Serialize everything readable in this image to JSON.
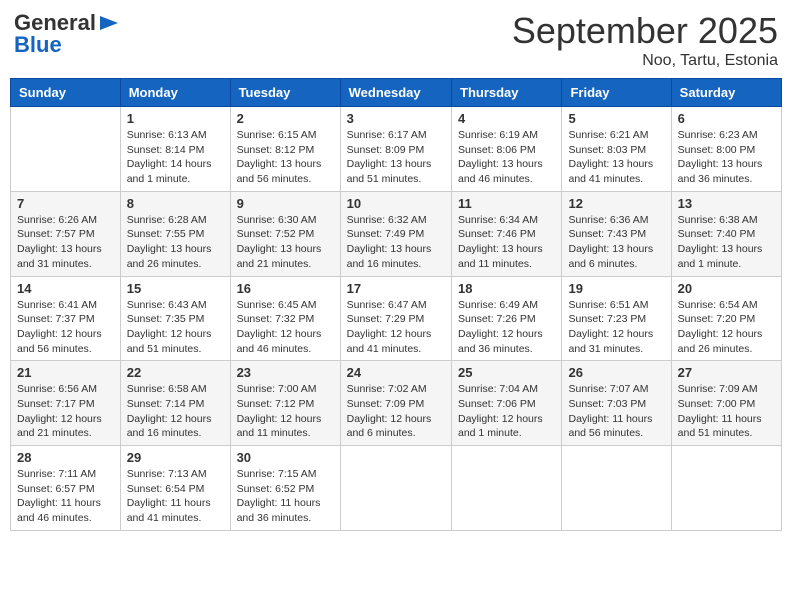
{
  "header": {
    "logo_general": "General",
    "logo_blue": "Blue",
    "month": "September 2025",
    "location": "Noo, Tartu, Estonia"
  },
  "weekdays": [
    "Sunday",
    "Monday",
    "Tuesday",
    "Wednesday",
    "Thursday",
    "Friday",
    "Saturday"
  ],
  "weeks": [
    [
      {
        "day": "",
        "info": ""
      },
      {
        "day": "1",
        "info": "Sunrise: 6:13 AM\nSunset: 8:14 PM\nDaylight: 14 hours\nand 1 minute."
      },
      {
        "day": "2",
        "info": "Sunrise: 6:15 AM\nSunset: 8:12 PM\nDaylight: 13 hours\nand 56 minutes."
      },
      {
        "day": "3",
        "info": "Sunrise: 6:17 AM\nSunset: 8:09 PM\nDaylight: 13 hours\nand 51 minutes."
      },
      {
        "day": "4",
        "info": "Sunrise: 6:19 AM\nSunset: 8:06 PM\nDaylight: 13 hours\nand 46 minutes."
      },
      {
        "day": "5",
        "info": "Sunrise: 6:21 AM\nSunset: 8:03 PM\nDaylight: 13 hours\nand 41 minutes."
      },
      {
        "day": "6",
        "info": "Sunrise: 6:23 AM\nSunset: 8:00 PM\nDaylight: 13 hours\nand 36 minutes."
      }
    ],
    [
      {
        "day": "7",
        "info": "Sunrise: 6:26 AM\nSunset: 7:57 PM\nDaylight: 13 hours\nand 31 minutes."
      },
      {
        "day": "8",
        "info": "Sunrise: 6:28 AM\nSunset: 7:55 PM\nDaylight: 13 hours\nand 26 minutes."
      },
      {
        "day": "9",
        "info": "Sunrise: 6:30 AM\nSunset: 7:52 PM\nDaylight: 13 hours\nand 21 minutes."
      },
      {
        "day": "10",
        "info": "Sunrise: 6:32 AM\nSunset: 7:49 PM\nDaylight: 13 hours\nand 16 minutes."
      },
      {
        "day": "11",
        "info": "Sunrise: 6:34 AM\nSunset: 7:46 PM\nDaylight: 13 hours\nand 11 minutes."
      },
      {
        "day": "12",
        "info": "Sunrise: 6:36 AM\nSunset: 7:43 PM\nDaylight: 13 hours\nand 6 minutes."
      },
      {
        "day": "13",
        "info": "Sunrise: 6:38 AM\nSunset: 7:40 PM\nDaylight: 13 hours\nand 1 minute."
      }
    ],
    [
      {
        "day": "14",
        "info": "Sunrise: 6:41 AM\nSunset: 7:37 PM\nDaylight: 12 hours\nand 56 minutes."
      },
      {
        "day": "15",
        "info": "Sunrise: 6:43 AM\nSunset: 7:35 PM\nDaylight: 12 hours\nand 51 minutes."
      },
      {
        "day": "16",
        "info": "Sunrise: 6:45 AM\nSunset: 7:32 PM\nDaylight: 12 hours\nand 46 minutes."
      },
      {
        "day": "17",
        "info": "Sunrise: 6:47 AM\nSunset: 7:29 PM\nDaylight: 12 hours\nand 41 minutes."
      },
      {
        "day": "18",
        "info": "Sunrise: 6:49 AM\nSunset: 7:26 PM\nDaylight: 12 hours\nand 36 minutes."
      },
      {
        "day": "19",
        "info": "Sunrise: 6:51 AM\nSunset: 7:23 PM\nDaylight: 12 hours\nand 31 minutes."
      },
      {
        "day": "20",
        "info": "Sunrise: 6:54 AM\nSunset: 7:20 PM\nDaylight: 12 hours\nand 26 minutes."
      }
    ],
    [
      {
        "day": "21",
        "info": "Sunrise: 6:56 AM\nSunset: 7:17 PM\nDaylight: 12 hours\nand 21 minutes."
      },
      {
        "day": "22",
        "info": "Sunrise: 6:58 AM\nSunset: 7:14 PM\nDaylight: 12 hours\nand 16 minutes."
      },
      {
        "day": "23",
        "info": "Sunrise: 7:00 AM\nSunset: 7:12 PM\nDaylight: 12 hours\nand 11 minutes."
      },
      {
        "day": "24",
        "info": "Sunrise: 7:02 AM\nSunset: 7:09 PM\nDaylight: 12 hours\nand 6 minutes."
      },
      {
        "day": "25",
        "info": "Sunrise: 7:04 AM\nSunset: 7:06 PM\nDaylight: 12 hours\nand 1 minute."
      },
      {
        "day": "26",
        "info": "Sunrise: 7:07 AM\nSunset: 7:03 PM\nDaylight: 11 hours\nand 56 minutes."
      },
      {
        "day": "27",
        "info": "Sunrise: 7:09 AM\nSunset: 7:00 PM\nDaylight: 11 hours\nand 51 minutes."
      }
    ],
    [
      {
        "day": "28",
        "info": "Sunrise: 7:11 AM\nSunset: 6:57 PM\nDaylight: 11 hours\nand 46 minutes."
      },
      {
        "day": "29",
        "info": "Sunrise: 7:13 AM\nSunset: 6:54 PM\nDaylight: 11 hours\nand 41 minutes."
      },
      {
        "day": "30",
        "info": "Sunrise: 7:15 AM\nSunset: 6:52 PM\nDaylight: 11 hours\nand 36 minutes."
      },
      {
        "day": "",
        "info": ""
      },
      {
        "day": "",
        "info": ""
      },
      {
        "day": "",
        "info": ""
      },
      {
        "day": "",
        "info": ""
      }
    ]
  ]
}
